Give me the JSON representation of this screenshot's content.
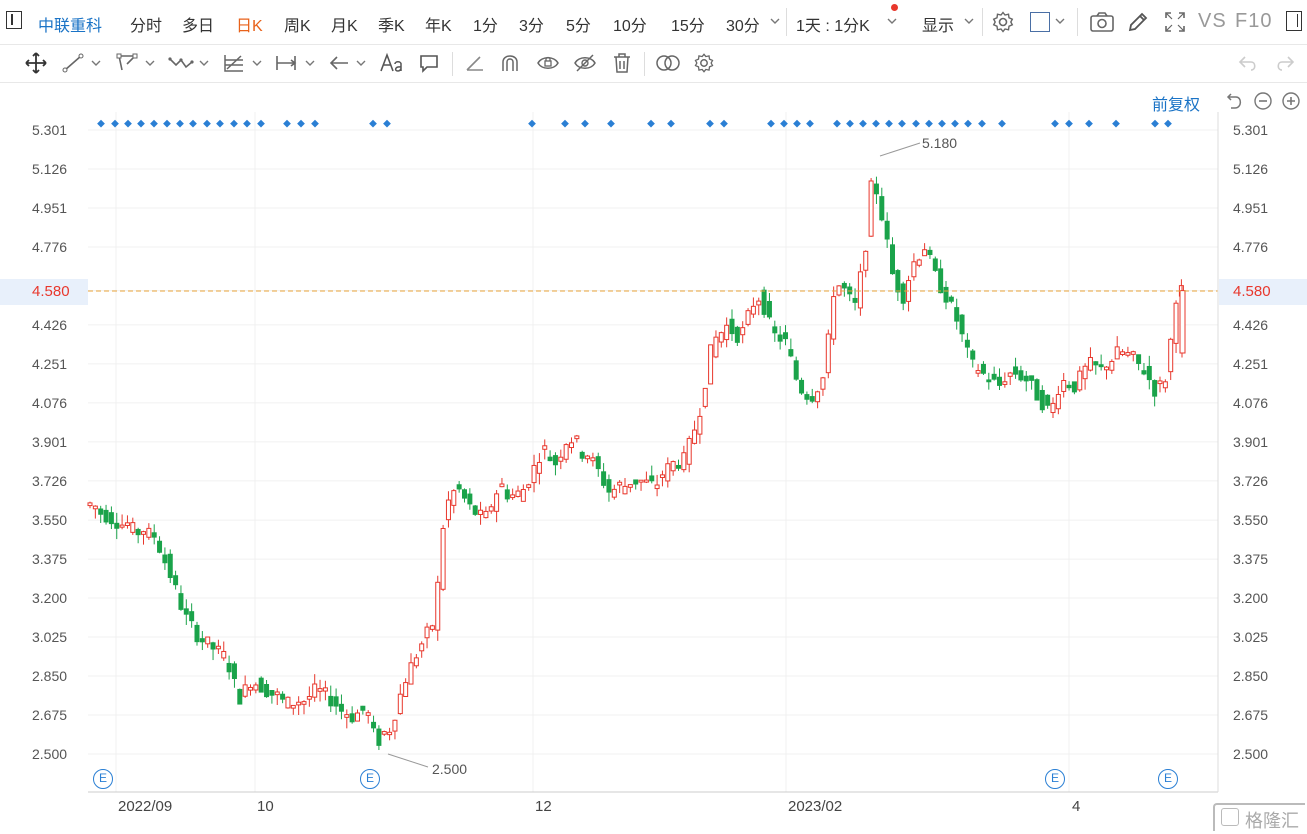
{
  "header": {
    "stock_name": "中联重科",
    "tabs": [
      "分时",
      "多日",
      "日K",
      "周K",
      "月K",
      "季K",
      "年K",
      "1分",
      "3分",
      "5分",
      "10分",
      "15分",
      "30分"
    ],
    "active_tab": "日K",
    "period_select": "1天 : 1分K",
    "display_menu": "显示",
    "vs_label": "VS",
    "f10_label": "F10"
  },
  "chart": {
    "adjust_label": "前复权",
    "y_ticks": [
      "5.301",
      "5.126",
      "4.951",
      "4.776",
      "4.580",
      "4.426",
      "4.251",
      "4.076",
      "3.901",
      "3.726",
      "3.550",
      "3.375",
      "3.200",
      "3.025",
      "2.850",
      "2.675",
      "2.500"
    ],
    "current_price": "4.580",
    "x_labels": [
      "2022/09",
      "10",
      "12",
      "2023/02",
      "4"
    ],
    "high_annotation": "5.180",
    "low_annotation": "2.500",
    "event_marker": "E",
    "watermark": "格隆汇",
    "colors": {
      "up": "#e8372c",
      "down": "#1aa34a",
      "accent": "#1a73c6",
      "current_line": "#e8a33a"
    }
  }
}
